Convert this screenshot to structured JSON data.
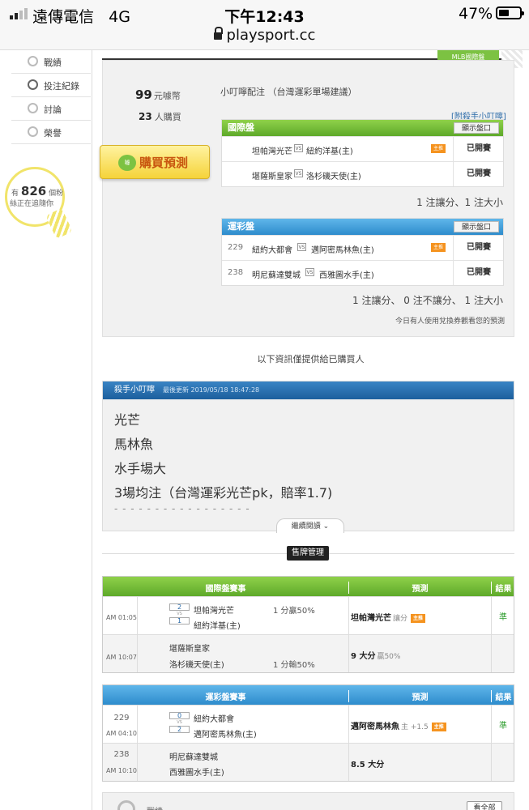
{
  "status_bar": {
    "carrier": "遠傳電信",
    "network": "4G",
    "time": "下午12:43",
    "battery_pct": "47%",
    "battery_level": 0.47,
    "url": "playsport.cc"
  },
  "sidebar": {
    "items": [
      {
        "label": "戰績",
        "icon": "chart-icon"
      },
      {
        "label": "投注紀錄",
        "icon": "circle-icon"
      },
      {
        "label": "討論",
        "icon": "chat-icon"
      },
      {
        "label": "榮譽",
        "icon": "medal-icon"
      }
    ],
    "fans_prefix": "有",
    "fans_count": "826",
    "fans_unit": "個粉",
    "fans_suffix": "絲正在追隨你"
  },
  "header": {
    "mlb_badge": "MLB國際盤"
  },
  "buy": {
    "price": "99",
    "price_unit": "元噱幣",
    "buyers": "23",
    "buyers_unit": "人購買",
    "button": "購買預測",
    "button_badge": "噱",
    "note_title": "小叮嚀配注 （台灣運彩單場建議）",
    "note_link": "[附殺手小叮嚀]"
  },
  "intl_panel": {
    "title": "國際盤",
    "show_button": "顯示盤口",
    "rows": [
      {
        "home": "坦帕灣光芒",
        "vs": "VS",
        "away": "紐約洋基(主)",
        "hot": "主推",
        "status": "已開賽"
      },
      {
        "home": "堪薩斯皇家",
        "vs": "VS",
        "away": "洛杉磯天使(主)",
        "status": "已開賽"
      }
    ],
    "summary": "1 注讓分、1 注大小"
  },
  "lottery_panel": {
    "title": "運彩盤",
    "show_button": "顯示盤口",
    "rows": [
      {
        "no": "229",
        "home": "紐約大都會",
        "vs": "VS",
        "away": "邁阿密馬林魚(主)",
        "hot": "主推",
        "status": "已開賽"
      },
      {
        "no": "238",
        "home": "明尼蘇達雙城",
        "vs": "VS",
        "away": "西雅圖水手(主)",
        "status": "已開賽"
      }
    ],
    "summary": "1 注讓分、 0 注不讓分、 1 注大小",
    "footnote": "今日有人使用兌換券觀看您的預測"
  },
  "info_line": "以下資訊僅提供給已購買人",
  "killer_note": {
    "title": "殺手小叮嚀",
    "updated": "最後更新 2019/05/18 18:47:28",
    "lines": [
      "光芒",
      "馬林魚",
      "水手場大",
      "3場均注（台灣運彩光芒pk，賠率1.7)"
    ],
    "dash": "- - - - - - - - - - - - - - - - -",
    "read_more": "繼續閱讀"
  },
  "section_tag": "售牌管理",
  "intl_table": {
    "headers": [
      "國際盤賽事",
      "預測",
      "結果"
    ],
    "rows": [
      {
        "time": "AM 01:05",
        "score_home": "2",
        "vs": "VS",
        "score_away": "1",
        "home": "坦帕灣光芒",
        "away": "紐約洋基(主)",
        "odds": "1 分贏50%",
        "pred": "坦帕灣光芒",
        "pred_sub": "讓分",
        "hot": "主推",
        "result": "準"
      },
      {
        "time": "AM 10:07",
        "home": "堪薩斯皇家",
        "away": "洛杉磯天使(主)",
        "odds": "1 分輸50%",
        "pred": "9 大分",
        "pred_sub": "贏50%",
        "result": ""
      }
    ]
  },
  "lottery_table": {
    "headers": [
      "運彩盤賽事",
      "預測",
      "結果"
    ],
    "rows": [
      {
        "no": "229",
        "time": "AM 04:10",
        "score_home": "0",
        "vs": "VS",
        "score_away": "2",
        "home": "紐約大都會",
        "away": "邁阿密馬林魚(主)",
        "pred": "邁阿密馬林魚",
        "pred_sub": "主 +1.5",
        "hot": "主推",
        "result": "準"
      },
      {
        "no": "238",
        "time": "AM 10:10",
        "home": "明尼蘇達雙城",
        "away": "西雅圖水手(主)",
        "pred": "8.5 大分",
        "result": ""
      }
    ]
  },
  "footer": {
    "label": "戰績",
    "more": "看全部"
  }
}
